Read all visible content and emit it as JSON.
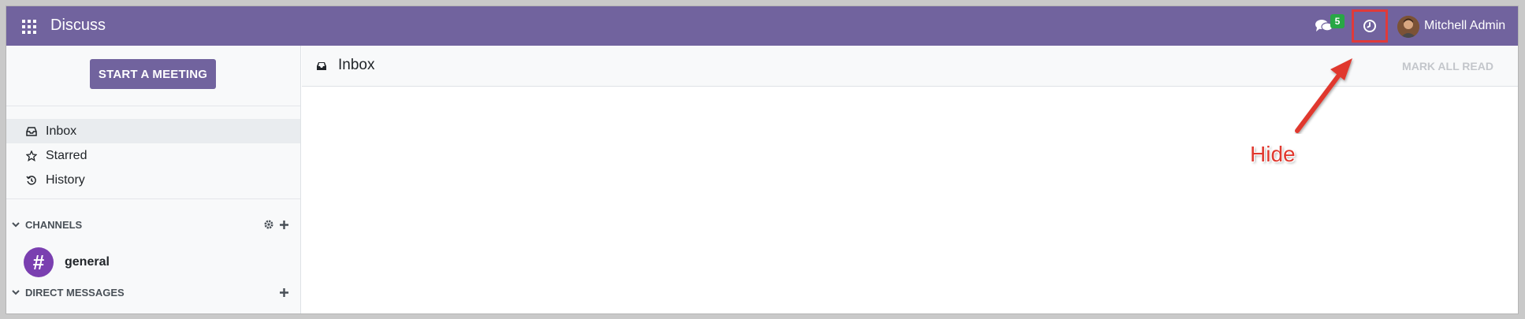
{
  "navbar": {
    "app_title": "Discuss",
    "chat_badge": "5",
    "user_name": "Mitchell Admin"
  },
  "sidebar": {
    "start_meeting_label": "START A MEETING",
    "mailboxes": [
      {
        "label": "Inbox",
        "icon": "inbox-icon",
        "active": true
      },
      {
        "label": "Starred",
        "icon": "star-icon",
        "active": false
      },
      {
        "label": "History",
        "icon": "history-icon",
        "active": false
      }
    ],
    "channels_header": "CHANNELS",
    "channels": [
      {
        "name": "general",
        "icon": "#"
      }
    ],
    "direct_messages_header": "DIRECT MESSAGES"
  },
  "thread": {
    "title": "Inbox",
    "mark_all_read_label": "MARK ALL READ"
  },
  "annotation": {
    "text": "Hide",
    "color": "#e0392f"
  },
  "colors": {
    "brand": "#71639e",
    "badge": "#28a745",
    "channel_avatar": "#7a3fb0"
  }
}
